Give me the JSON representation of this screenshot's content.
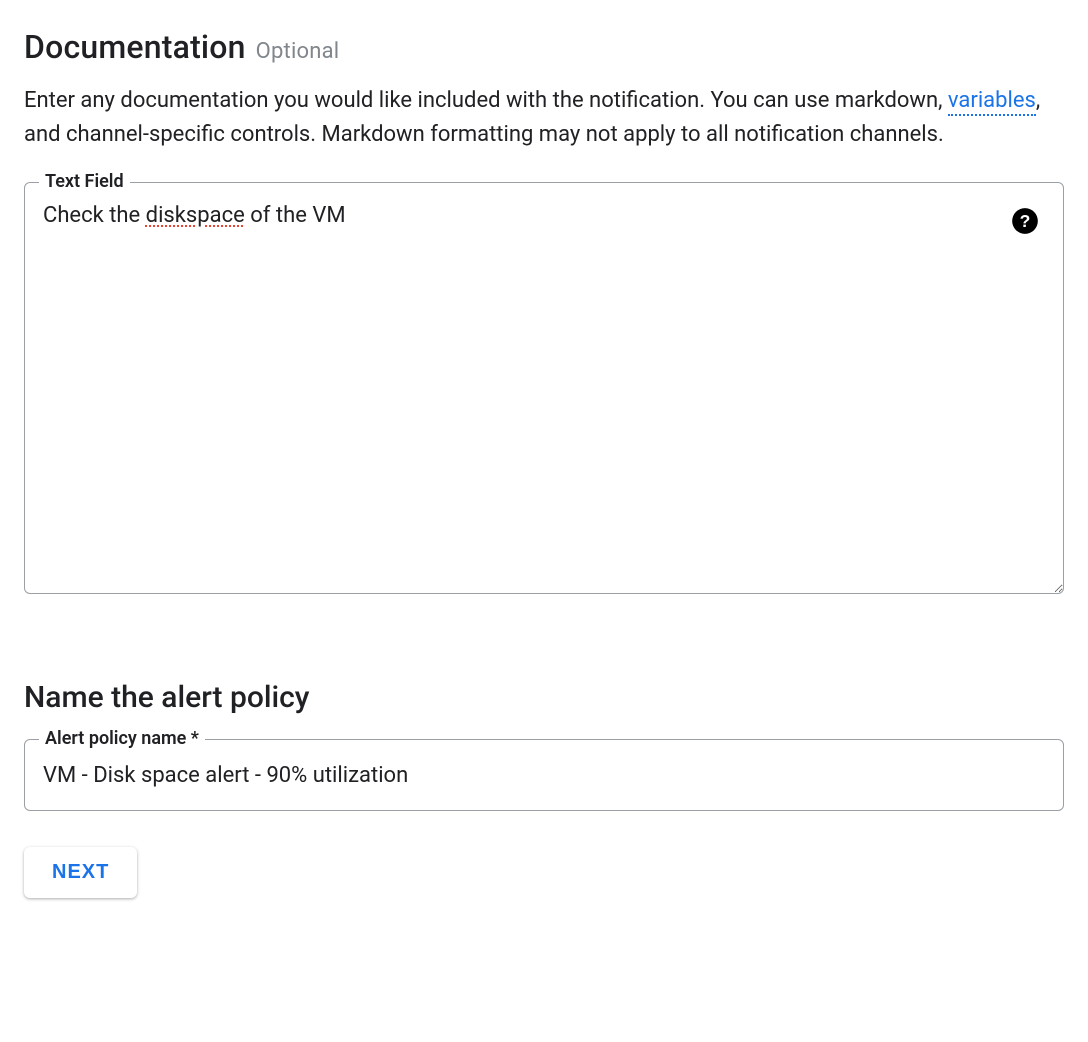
{
  "documentation": {
    "heading": "Documentation",
    "optional": "Optional",
    "description_pre": "Enter any documentation you would like included with the notification. You can use markdown, ",
    "link_text": "variables",
    "description_post": ", and channel-specific controls. Markdown formatting may not apply to all notification channels.",
    "field_label": "Text Field",
    "text_value": "Check the diskspace of the VM",
    "text_plain": "Check the ",
    "text_spell": "diskspace",
    "text_after": " of the VM"
  },
  "name_section": {
    "heading": "Name the alert policy",
    "field_label": "Alert policy name *",
    "value": "VM - Disk space alert - 90% utilization"
  },
  "actions": {
    "next": "NEXT"
  }
}
